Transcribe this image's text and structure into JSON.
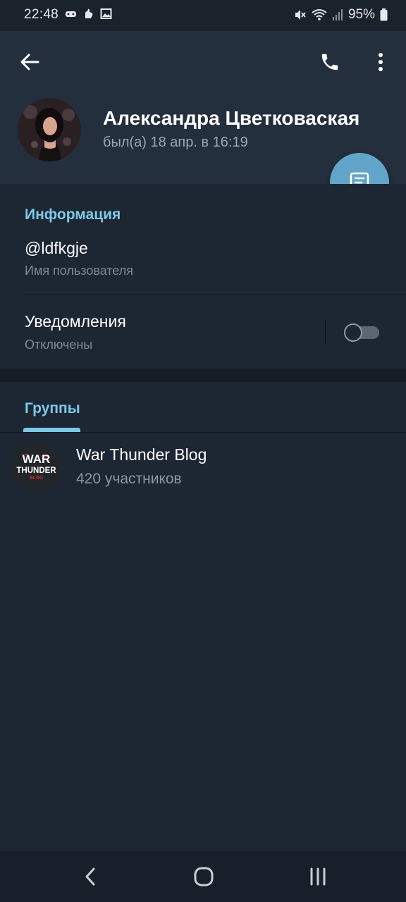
{
  "status_bar": {
    "time": "22:48",
    "battery": "95%",
    "icons": [
      "gamepad-icon",
      "hand-icon",
      "image-icon",
      "mute-icon",
      "wifi-icon",
      "signal-icon",
      "battery-icon"
    ]
  },
  "header": {
    "back_icon": "arrow-left-icon",
    "call_icon": "phone-icon",
    "menu_icon": "more-vertical-icon",
    "name": "Александра Цветковаская",
    "last_seen": "был(а) 18 апр. в 16:19",
    "fab_icon": "message-icon"
  },
  "info": {
    "section_title": "Информация",
    "username": "@ldfkgje",
    "username_label": "Имя пользователя",
    "notifications_title": "Уведомления",
    "notifications_status": "Отключены",
    "notifications_enabled": false
  },
  "groups": {
    "tab_label": "Группы",
    "items": [
      {
        "name": "War Thunder Blog",
        "members": "420 участников",
        "logo_text": [
          "WAR",
          "THUNDER",
          "BLOG"
        ]
      }
    ]
  },
  "nav_bar": {
    "icons": [
      "back-icon",
      "home-icon",
      "recents-icon"
    ]
  },
  "colors": {
    "background": "#1d2733",
    "header": "#242f3d",
    "accent": "#7ec8e8",
    "fab": "#62a5c9",
    "secondary_text": "#7d8a97"
  }
}
